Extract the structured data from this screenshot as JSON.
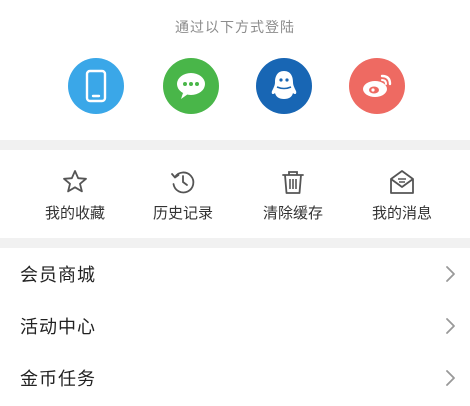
{
  "login": {
    "title": "通过以下方式登陆",
    "methods": [
      {
        "id": "phone",
        "icon": "phone-icon",
        "color": "#3aa7e8"
      },
      {
        "id": "wechat",
        "icon": "wechat-icon",
        "color": "#49b649"
      },
      {
        "id": "qq",
        "icon": "qq-icon",
        "color": "#1866b4"
      },
      {
        "id": "weibo",
        "icon": "weibo-icon",
        "color": "#ee6a62"
      }
    ]
  },
  "quick_actions": [
    {
      "label": "我的收藏",
      "icon": "star-icon"
    },
    {
      "label": "历史记录",
      "icon": "history-clock-icon"
    },
    {
      "label": "清除缓存",
      "icon": "trash-icon"
    },
    {
      "label": "我的消息",
      "icon": "mail-icon"
    }
  ],
  "menu": [
    {
      "label": "会员商城",
      "icon": "chevron-right-icon"
    },
    {
      "label": "活动中心",
      "icon": "chevron-right-icon"
    },
    {
      "label": "金币任务",
      "icon": "chevron-right-icon"
    }
  ],
  "colors": {
    "background": "#ffffff",
    "divider": "#f1f1f1",
    "title_gray": "#8c8c8c",
    "text_dark": "#222222",
    "icon_gray": "#555555",
    "chevron_gray": "#999999"
  }
}
